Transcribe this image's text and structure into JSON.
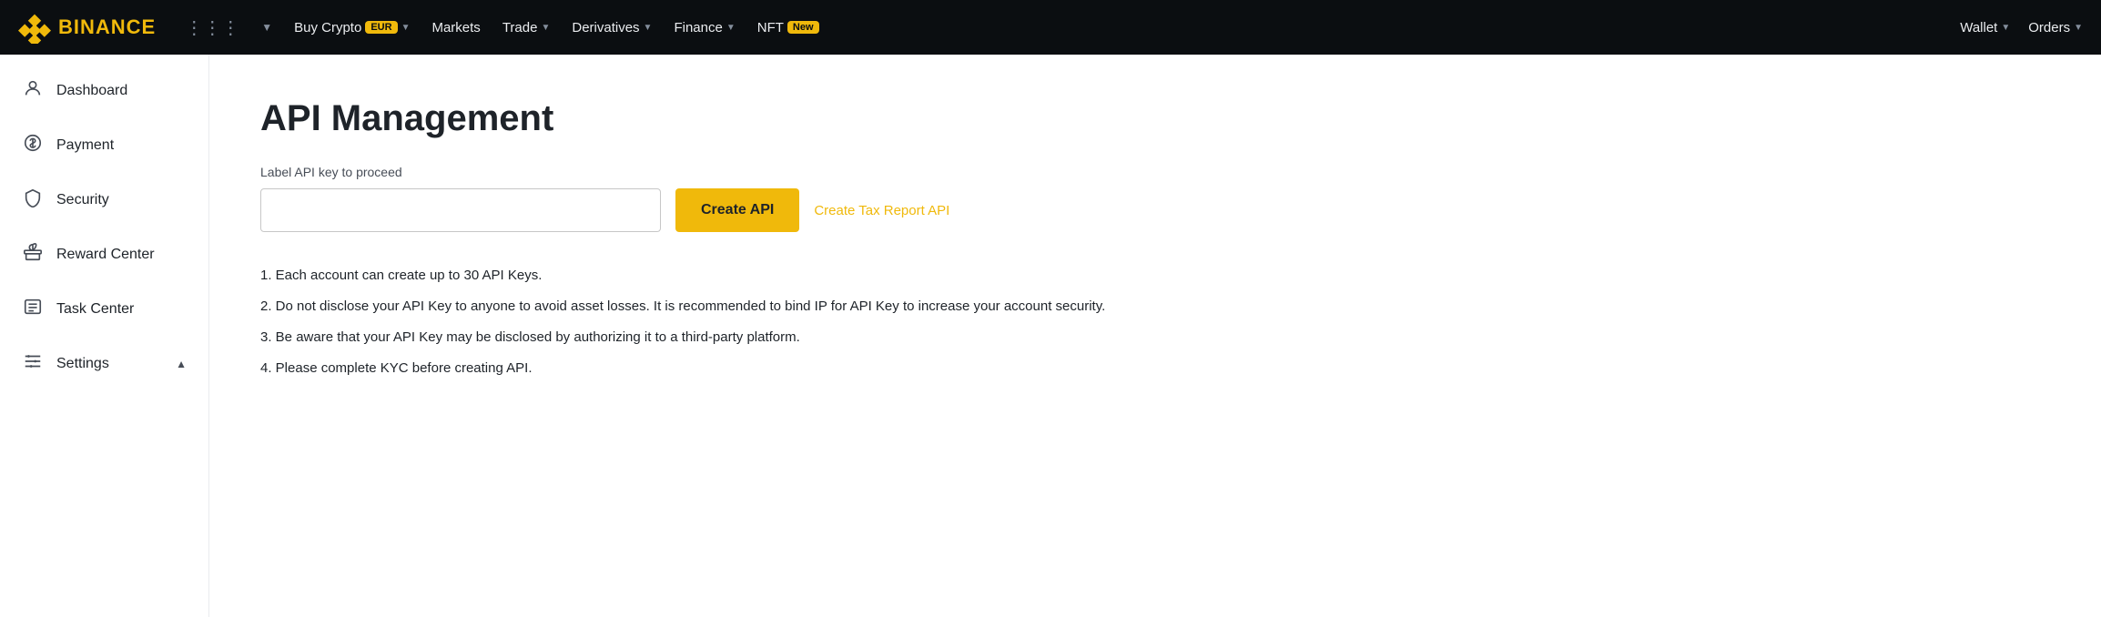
{
  "topnav": {
    "logo_text": "BINANCE",
    "buy_crypto": "Buy Crypto",
    "buy_crypto_badge": "EUR",
    "markets": "Markets",
    "trade": "Trade",
    "derivatives": "Derivatives",
    "finance": "Finance",
    "nft": "NFT",
    "nft_badge": "New",
    "wallet": "Wallet",
    "orders": "Orders"
  },
  "sidebar": {
    "dashboard": "Dashboard",
    "payment": "Payment",
    "security": "Security",
    "reward_center": "Reward Center",
    "task_center": "Task Center",
    "settings": "Settings"
  },
  "main": {
    "title": "API Management",
    "input_label": "Label API key to proceed",
    "input_placeholder": "",
    "btn_create": "Create API",
    "link_tax": "Create Tax Report API",
    "info_items": [
      "1. Each account can create up to 30 API Keys.",
      "2. Do not disclose your API Key to anyone to avoid asset losses. It is recommended to bind IP for API Key to increase your account security.",
      "3. Be aware that your API Key may be disclosed by authorizing it to a third-party platform.",
      "4. Please complete KYC before creating API."
    ]
  }
}
